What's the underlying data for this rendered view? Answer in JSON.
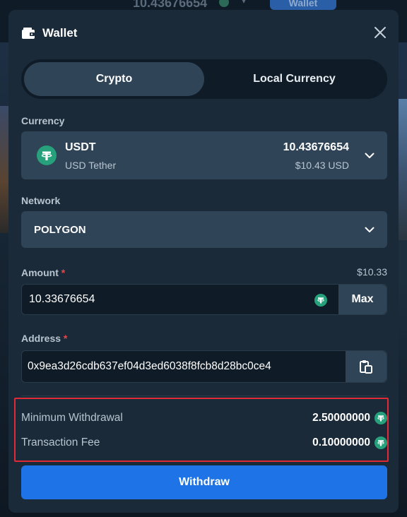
{
  "background": {
    "balance": "10.43676654",
    "wallet_button": "Wallet"
  },
  "modal": {
    "title": "Wallet",
    "icons": {
      "title": "wallet-icon",
      "close": "close-icon"
    }
  },
  "tabs": [
    {
      "label": "Crypto",
      "active": true
    },
    {
      "label": "Local Currency",
      "active": false
    }
  ],
  "currency": {
    "label": "Currency",
    "code": "USDT",
    "name": "USD Tether",
    "balance": "10.43676654",
    "balance_usd": "$10.43 USD",
    "icon": "tether-icon"
  },
  "network": {
    "label": "Network",
    "value": "POLYGON"
  },
  "amount": {
    "label": "Amount",
    "required_mark": "*",
    "usd_value": "$10.33",
    "value": "10.33676654",
    "max_label": "Max"
  },
  "address": {
    "label": "Address",
    "required_mark": "*",
    "value": "0x9ea3d26cdb637ef04d3ed6038f8fcb8d28bc0ce4",
    "paste_icon": "paste-icon"
  },
  "summary": {
    "min_withdrawal_label": "Minimum Withdrawal",
    "min_withdrawal_value": "2.50000000",
    "fee_label": "Transaction Fee",
    "fee_value": "0.10000000"
  },
  "withdraw_button": "Withdraw",
  "colors": {
    "modal_bg": "#1a2a38",
    "field_bg": "#2f4456",
    "input_bg": "#0f1b26",
    "accent": "#1e74e6",
    "tether_green": "#26a17b",
    "highlight_red": "#e02a36"
  }
}
